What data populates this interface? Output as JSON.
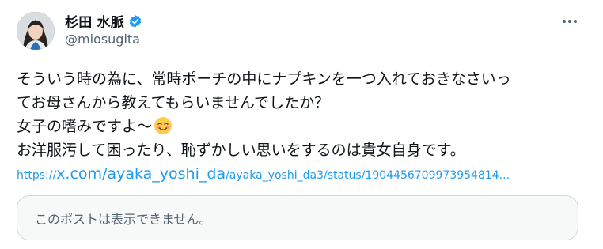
{
  "author": {
    "display_name": "杉田 水脈",
    "handle": "@miosugita",
    "verified": true
  },
  "tweet": {
    "lines": [
      "そういう時の為に、常時ポーチの中にナプキンを一つ入れておきなさいっ",
      "てお母さんから教えてもらいませんでしたか？",
      "女子の嗜みですよ〜",
      "お洋服汚して困ったり、恥ずかしい思いをするのは貴女自身です。"
    ],
    "emoji_icon": "smiling-face-with-blush-icon",
    "link": {
      "scheme": "https://",
      "domain": "x.com/ayaka_yoshi_da",
      "path": "/ayaka_yoshi_da3/status/1904456709973954814..."
    }
  },
  "quoted_post": {
    "unavailable_text": "このポストは表示できません。"
  },
  "icons": {
    "verified": "verified-badge-icon",
    "more": "more-options-icon"
  },
  "colors": {
    "text": "#0f1419",
    "secondary": "#536471",
    "link": "#1d9bf0",
    "verified": "#1d9bf0",
    "card_bg": "#f7f9f9",
    "card_border": "#cfd9de"
  }
}
